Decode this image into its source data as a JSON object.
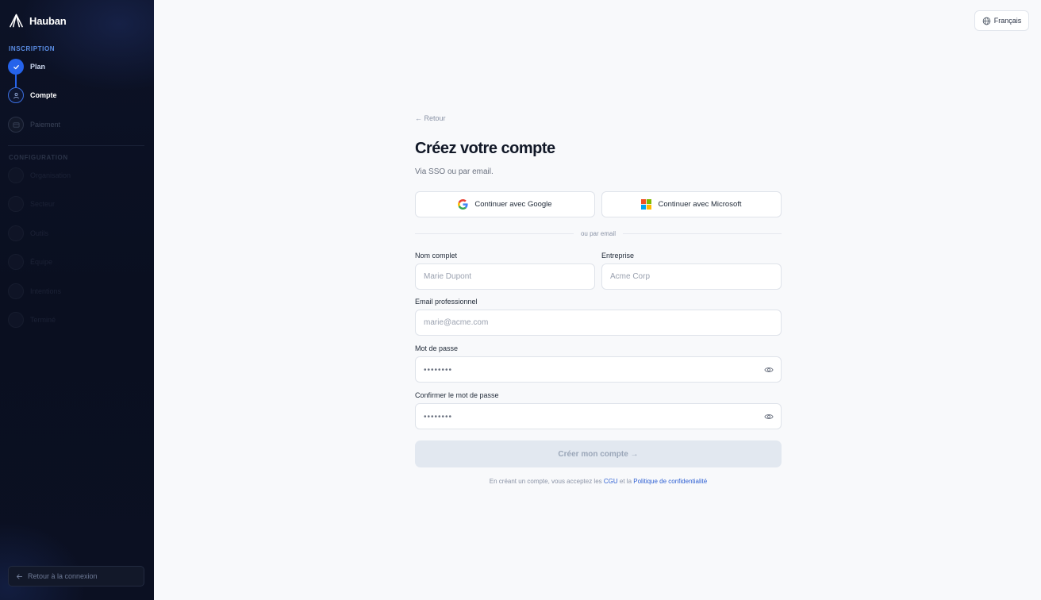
{
  "brand": {
    "name": "Hauban",
    "icon": "hauban-logo-icon"
  },
  "sidebar": {
    "section_inscription": "INSCRIPTION",
    "section_configuration": "CONFIGURATION",
    "steps": [
      {
        "label": "Plan",
        "state": "done",
        "icon": "check-icon"
      },
      {
        "label": "Compte",
        "state": "current",
        "icon": "user-icon"
      },
      {
        "label": "Paiement",
        "state": "pending",
        "icon": "card-icon"
      }
    ],
    "config_steps": [
      {
        "label": "Organisation"
      },
      {
        "label": "Secteur"
      },
      {
        "label": "Outils"
      },
      {
        "label": "Équipe"
      },
      {
        "label": "Intentions"
      },
      {
        "label": "Terminé"
      }
    ],
    "back_to_login": "Retour à la connexion"
  },
  "language": {
    "label": "Français",
    "icon": "globe-icon"
  },
  "form": {
    "back_link": "← Retour",
    "title": "Créez votre compte",
    "subtitle": "Via SSO ou par email.",
    "sso_google": "Continuer avec Google",
    "sso_microsoft": "Continuer avec Microsoft",
    "divider": "ou par email",
    "full_name": {
      "label": "Nom complet",
      "placeholder": "Marie Dupont"
    },
    "company": {
      "label": "Entreprise",
      "placeholder": "Acme Corp"
    },
    "email": {
      "label": "Email professionnel",
      "placeholder": "marie@acme.com"
    },
    "password": {
      "label": "Mot de passe",
      "placeholder": "••••••••"
    },
    "confirm_password": {
      "label": "Confirmer le mot de passe",
      "placeholder": "••••••••"
    },
    "submit": "Créer mon compte →",
    "terms_prefix": "En créant un compte, vous acceptez les",
    "terms_cgu": "CGU",
    "terms_and": "et la",
    "terms_privacy": "Politique de confidentialité"
  },
  "colors": {
    "accent": "#2563eb",
    "sidebar_bg": "#0b1022",
    "page_bg": "#f8f9fb",
    "submit_disabled": "#e2e8f0"
  }
}
